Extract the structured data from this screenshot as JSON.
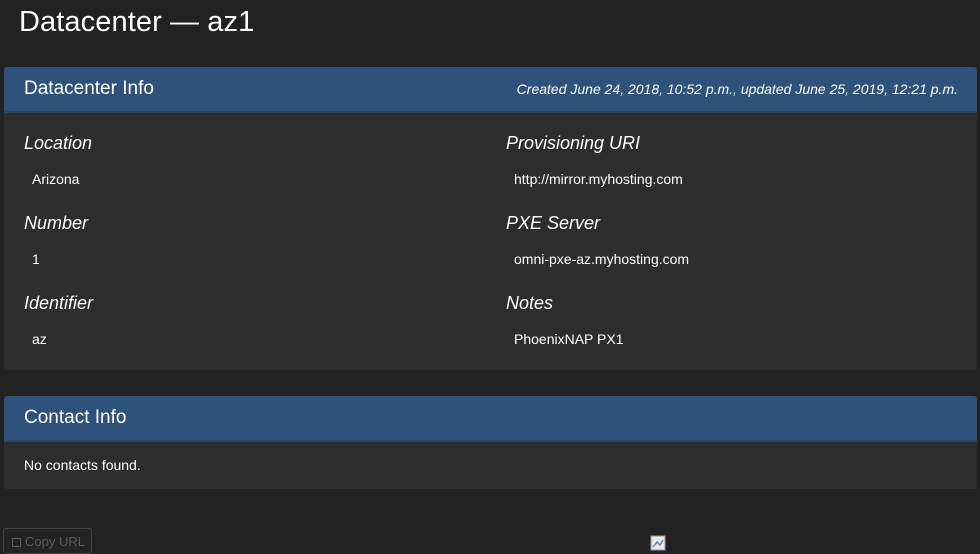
{
  "page": {
    "title": "Datacenter — az1"
  },
  "datacenter_info": {
    "title": "Datacenter Info",
    "meta": "Created June 24, 2018, 10:52 p.m., updated June 25, 2019, 12:21 p.m.",
    "fields": {
      "location": {
        "label": "Location",
        "value": "Arizona"
      },
      "number": {
        "label": "Number",
        "value": "1"
      },
      "identifier": {
        "label": "Identifier",
        "value": "az"
      },
      "provisioning_uri": {
        "label": "Provisioning URI",
        "value": "http://mirror.myhosting.com"
      },
      "pxe_server": {
        "label": "PXE Server",
        "value": "omni-pxe-az.myhosting.com"
      },
      "notes": {
        "label": "Notes",
        "value": "PhoenixNAP PX1"
      }
    }
  },
  "contact_info": {
    "title": "Contact Info",
    "empty_message": "No contacts found."
  },
  "footer": {
    "copy_url_label": "Copy URL"
  },
  "icons": {
    "copy": "copy-icon",
    "broken_image": "broken-image-icon"
  }
}
